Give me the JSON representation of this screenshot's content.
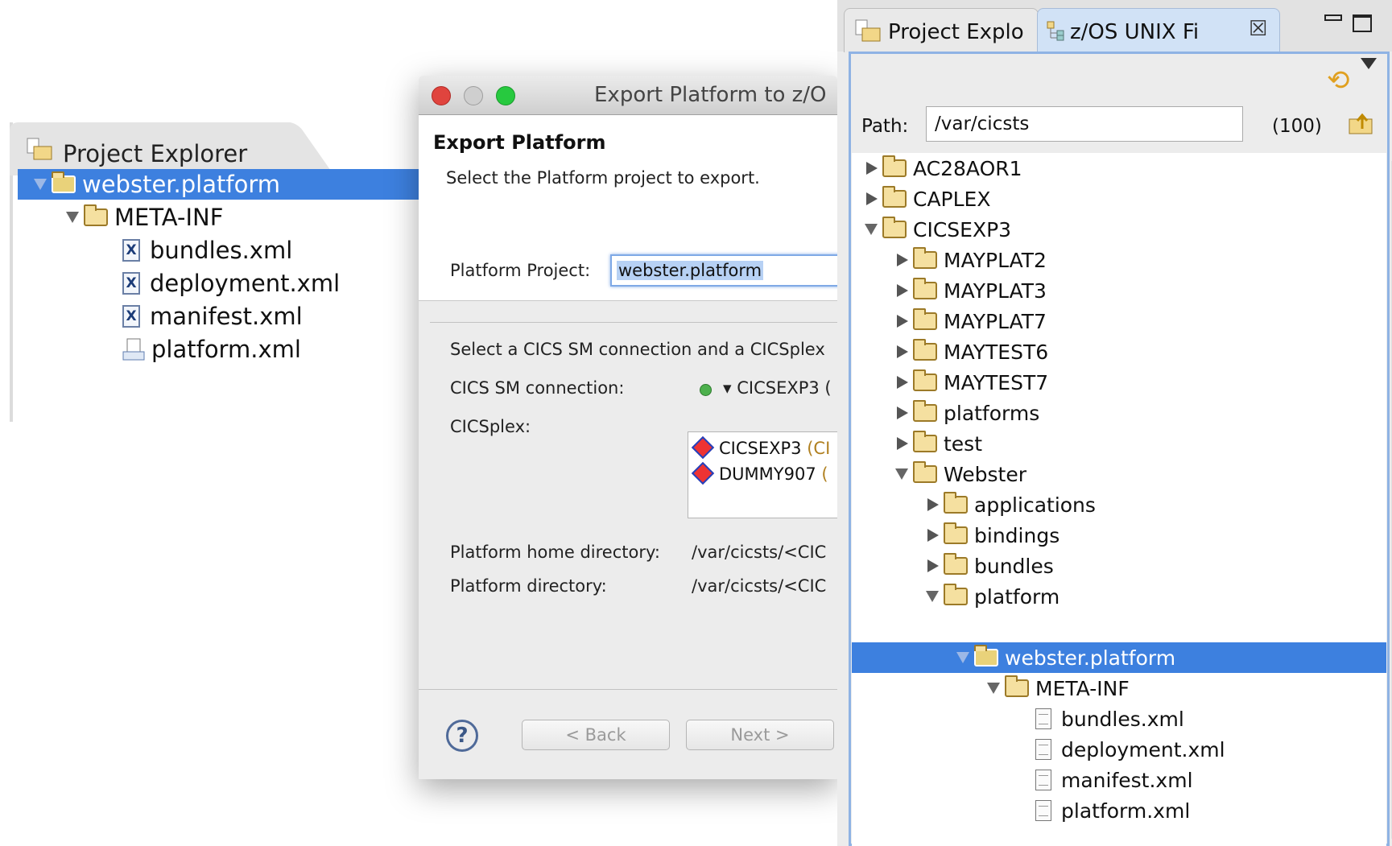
{
  "left_explorer": {
    "tab_title": "Project Explorer",
    "items": [
      {
        "label": "webster.platform"
      },
      {
        "label": "META-INF"
      },
      {
        "label": "bundles.xml"
      },
      {
        "label": "deployment.xml"
      },
      {
        "label": "manifest.xml"
      },
      {
        "label": "platform.xml"
      }
    ]
  },
  "dialog": {
    "title": "Export Platform to z/O",
    "header_title": "Export Platform",
    "header_subtitle": "Select the Platform project to export.",
    "platform_project_label": "Platform Project:",
    "platform_project_value": "webster.platform",
    "connection_prompt": "Select a CICS SM connection and a CICSplex",
    "connection_label": "CICS SM connection:",
    "connection_value": "▾ CICSEXP3 (",
    "cicsplex_label": "CICSplex:",
    "cicsplex_items": [
      {
        "name": "CICSEXP3",
        "suffix": "(CI"
      },
      {
        "name": "DUMMY907",
        "suffix": "("
      }
    ],
    "home_dir_label": "Platform home directory:",
    "home_dir_value": "/var/cicsts/<CIC",
    "platform_dir_label": "Platform directory:",
    "platform_dir_value": "/var/cicsts/<CIC",
    "help_label": "?",
    "back_label": "< Back",
    "next_label": "Next >"
  },
  "zos_panel": {
    "tab_project_explorer": "Project Explo",
    "tab_zos": "z/OS UNIX Fi",
    "close_glyph": "☒",
    "path_label": "Path:",
    "path_value": "/var/cicsts",
    "path_count": "(100)",
    "tree": [
      {
        "label": "AC28AOR1"
      },
      {
        "label": "CAPLEX"
      },
      {
        "label": "CICSEXP3"
      },
      {
        "label": "MAYPLAT2"
      },
      {
        "label": "MAYPLAT3"
      },
      {
        "label": "MAYPLAT7"
      },
      {
        "label": "MAYTEST6"
      },
      {
        "label": "MAYTEST7"
      },
      {
        "label": "platforms"
      },
      {
        "label": "test"
      },
      {
        "label": "Webster"
      },
      {
        "label": "applications"
      },
      {
        "label": "bindings"
      },
      {
        "label": "bundles"
      },
      {
        "label": "platform"
      },
      {
        "label": "webster.platform"
      },
      {
        "label": "META-INF"
      },
      {
        "label": "bundles.xml"
      },
      {
        "label": "deployment.xml"
      },
      {
        "label": "manifest.xml"
      },
      {
        "label": "platform.xml"
      }
    ]
  },
  "colors": {
    "selection": "#3d80df",
    "close_light": "#e0443e",
    "minimize_light": "#cfcfcf",
    "zoom_light": "#27c93f"
  }
}
